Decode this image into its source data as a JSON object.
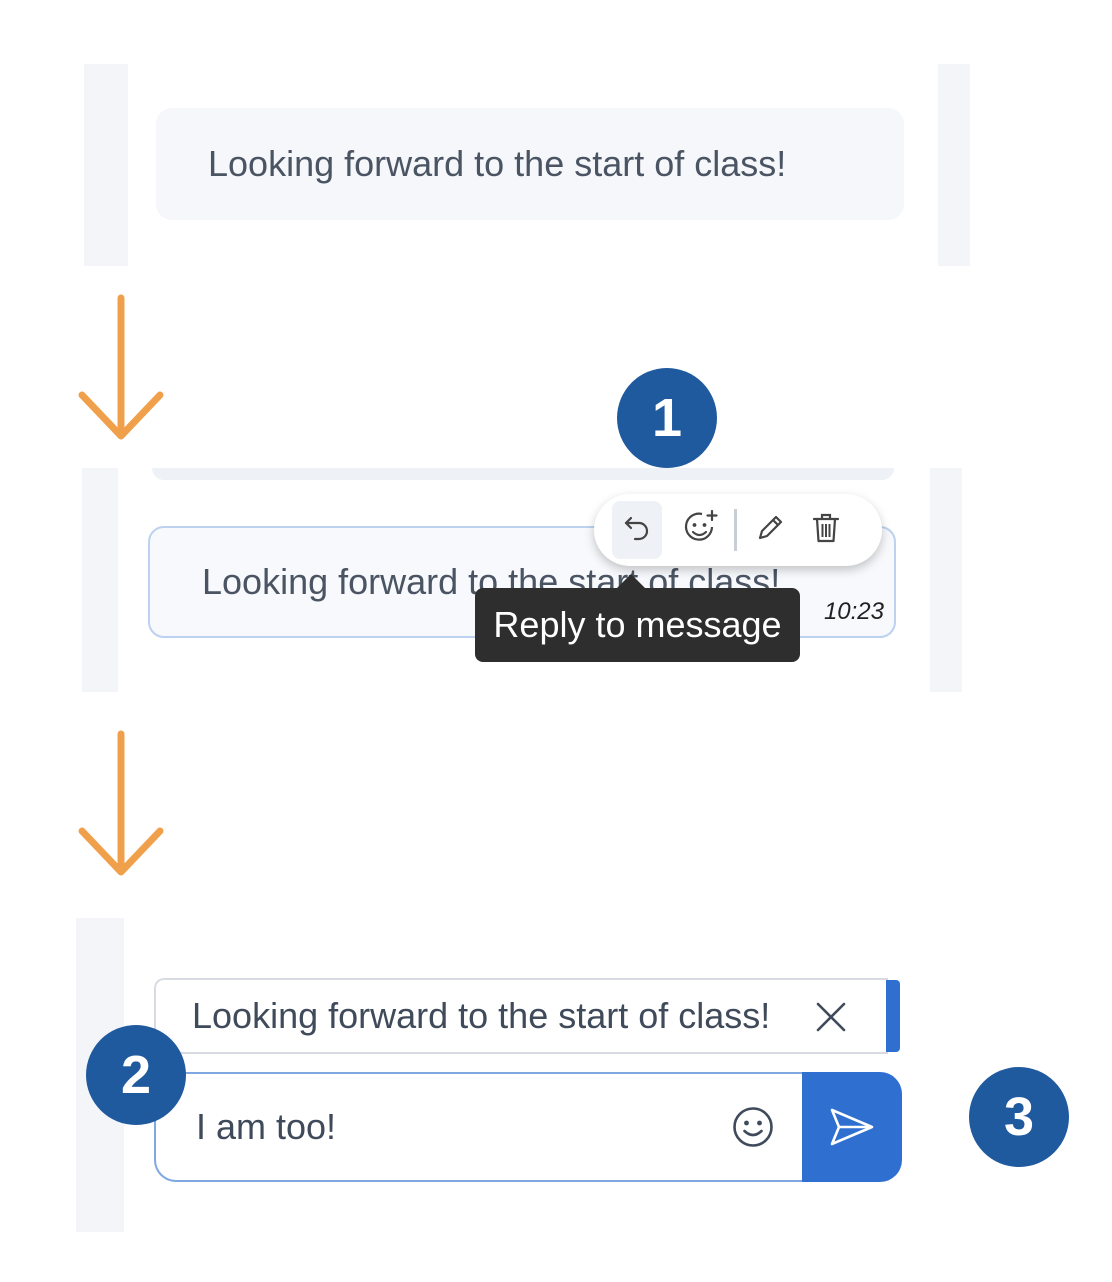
{
  "step1": {
    "message_text": "Looking forward to the start of class!"
  },
  "step2": {
    "message_text": "Looking forward to the start of class!",
    "timestamp": "10:23",
    "toolbar": {
      "reply_icon": "reply-icon",
      "react_icon": "add-reaction-icon",
      "edit_icon": "pencil-icon",
      "delete_icon": "trash-icon"
    },
    "tooltip": "Reply to message"
  },
  "step3": {
    "reply_quote": "Looking forward to the start of class!",
    "input_value": "I am too!",
    "emoji_icon": "smiley-icon",
    "send_icon": "send-icon"
  },
  "badges": [
    "1",
    "2",
    "3"
  ],
  "colors": {
    "arrow": "#f0a04b",
    "badge": "#1f5a9e",
    "accent": "#2f6fd0",
    "tooltip_bg": "#2e2e2e"
  }
}
